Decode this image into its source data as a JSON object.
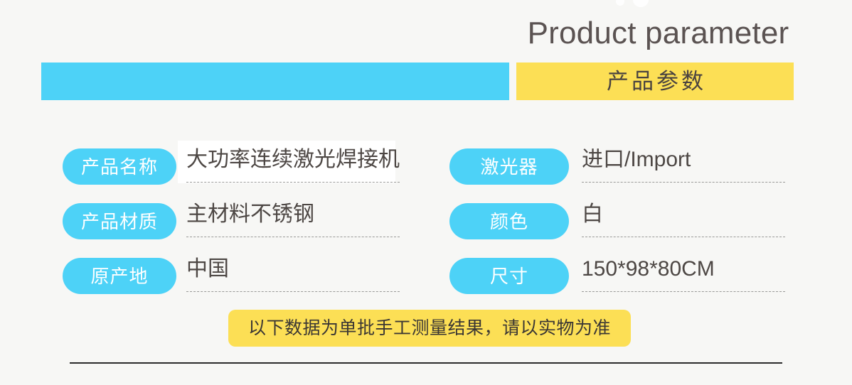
{
  "header": {
    "title_en": "Product parameter",
    "title_cn": "产品参数",
    "blue_bar_color": "#4dd2f7",
    "yellow_bar_color": "#fcdf55",
    "title_en_color": "#5b5352"
  },
  "params": {
    "left_column": [
      {
        "label": "产品名称",
        "value": "大功率连续激光焊接机",
        "highlighted": true
      },
      {
        "label": "产品材质",
        "value": "主材料不锈钢",
        "highlighted": false
      },
      {
        "label": "原产地",
        "value": "中国",
        "highlighted": false
      }
    ],
    "right_column": [
      {
        "label": "激光器",
        "value": "进口/Import",
        "highlighted": false
      },
      {
        "label": "颜色",
        "value": "白",
        "highlighted": false
      },
      {
        "label": "尺寸",
        "value": "150*98*80CM",
        "highlighted": false
      }
    ]
  },
  "note": {
    "text": "以下数据为单批手工测量结果，请以实物为准",
    "background_color": "#fcdf55"
  },
  "theme": {
    "page_background": "#f7f7f5",
    "pill_color": "#4dd2f7",
    "pill_text_color": "#ffffff",
    "value_text_color": "#4d4744",
    "divider_color": "#2b2b2b"
  }
}
